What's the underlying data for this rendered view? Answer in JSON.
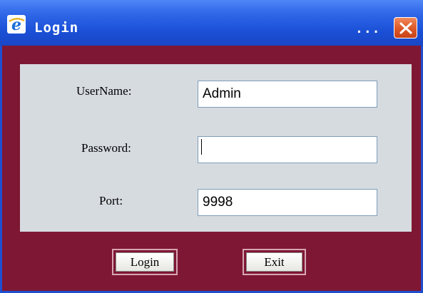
{
  "window": {
    "title": "Login",
    "title_menu": "...",
    "icons": {
      "app": "internet-explorer-icon",
      "close": "close-icon"
    },
    "colors": {
      "titlebar": "#2f67e8",
      "background": "#7e1733",
      "panel": "#d6dbe0",
      "close_button": "#de5b2b"
    }
  },
  "form": {
    "username": {
      "label": "UserName:",
      "value": "Admin"
    },
    "password": {
      "label": "Password:",
      "value": ""
    },
    "port": {
      "label": "Port:",
      "value": "9998"
    }
  },
  "buttons": {
    "login": "Login",
    "exit": "Exit"
  }
}
